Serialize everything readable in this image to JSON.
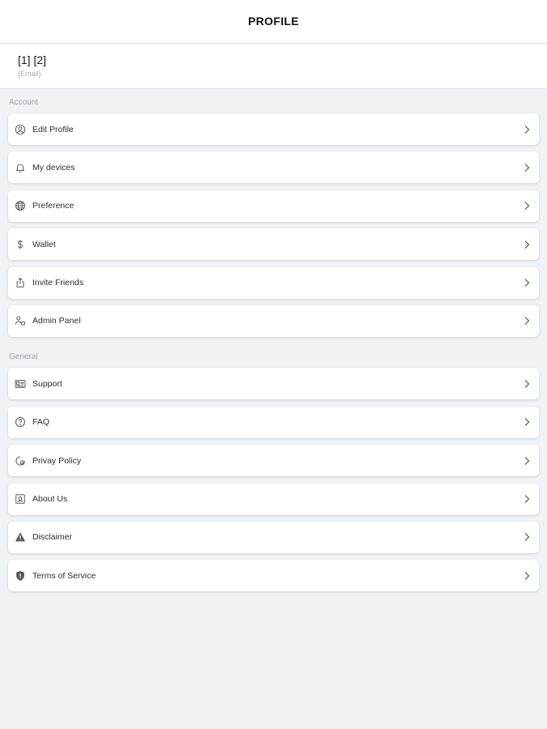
{
  "header": {
    "title": "PROFILE"
  },
  "user": {
    "name": "[1] [2]",
    "email": "{Email}"
  },
  "sections": [
    {
      "title": "Account",
      "items": [
        {
          "label": "Edit Profile",
          "icon": "user-circle-icon"
        },
        {
          "label": "My devices",
          "icon": "bell-icon"
        },
        {
          "label": "Preference",
          "icon": "globe-icon"
        },
        {
          "label": "Wallet",
          "icon": "dollar-icon"
        },
        {
          "label": "Invite Friends",
          "icon": "share-icon"
        },
        {
          "label": "Admin Panel",
          "icon": "admin-user-icon"
        }
      ]
    },
    {
      "title": "General",
      "items": [
        {
          "label": "Support",
          "icon": "id-card-icon"
        },
        {
          "label": "FAQ",
          "icon": "question-circle-icon"
        },
        {
          "label": "Privay Policy",
          "icon": "privacy-icon"
        },
        {
          "label": "About Us",
          "icon": "info-box-icon"
        },
        {
          "label": "Disclaimer",
          "icon": "warning-icon"
        },
        {
          "label": "Terms of Service",
          "icon": "shield-icon"
        }
      ]
    }
  ]
}
